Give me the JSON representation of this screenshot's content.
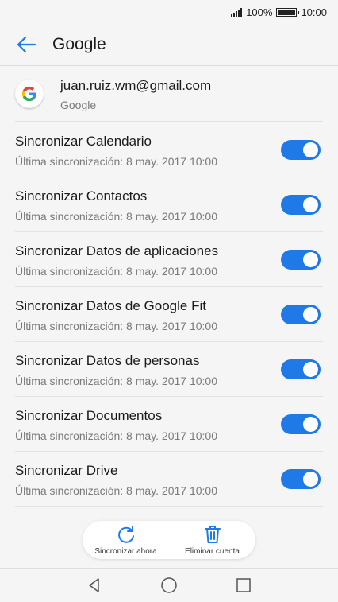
{
  "status_bar": {
    "battery": "100%",
    "time": "10:00",
    "icons": [
      "signal-icon",
      "battery-icon"
    ]
  },
  "header": {
    "title": "Google",
    "back_icon": "arrow-left-icon"
  },
  "account": {
    "email": "juan.ruiz.wm@gmail.com",
    "type": "Google",
    "logo": "google-g-icon"
  },
  "sync_items": [
    {
      "label": "Sincronizar Calendario",
      "last_sync": "Última sincronización: 8 may. 2017 10:00",
      "enabled": true
    },
    {
      "label": "Sincronizar Contactos",
      "last_sync": "Última sincronización: 8 may. 2017 10:00",
      "enabled": true
    },
    {
      "label": "Sincronizar Datos de aplicaciones",
      "last_sync": "Última sincronización: 8 may. 2017 10:00",
      "enabled": true
    },
    {
      "label": "Sincronizar Datos de Google Fit",
      "last_sync": "Última sincronización: 8 may. 2017 10:00",
      "enabled": true
    },
    {
      "label": "Sincronizar Datos de personas",
      "last_sync": "Última sincronización: 8 may. 2017 10:00",
      "enabled": true
    },
    {
      "label": "Sincronizar Documentos",
      "last_sync": "Última sincronización: 8 may. 2017 10:00",
      "enabled": true
    },
    {
      "label": "Sincronizar Drive",
      "last_sync": "Última sincronización: 8 may. 2017 10:00",
      "enabled": true
    }
  ],
  "actions": {
    "sync_now": "Sincronizar ahora",
    "remove_account": "Eliminar cuenta"
  },
  "colors": {
    "accent": "#1f7ae8",
    "background": "#f5f5f5"
  },
  "nav": [
    "back-triangle-icon",
    "home-circle-icon",
    "recents-square-icon"
  ]
}
